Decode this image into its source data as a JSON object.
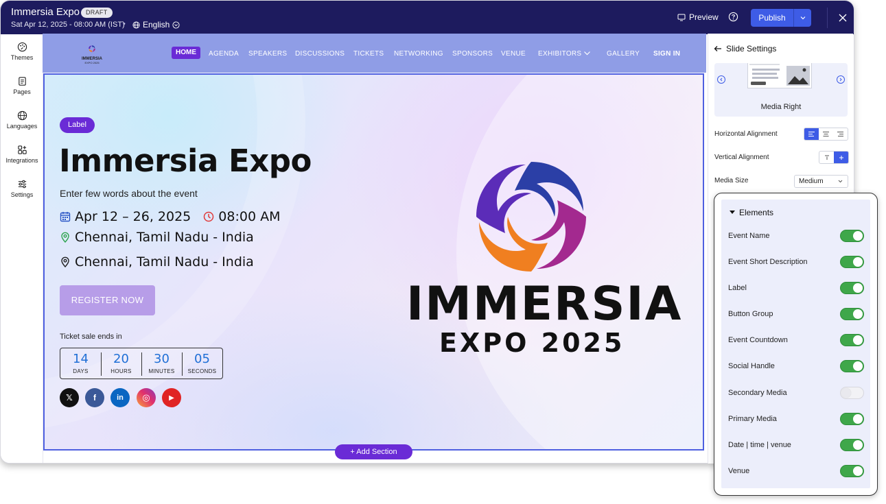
{
  "header": {
    "app_title": "Immersia Expo",
    "status_badge": "DRAFT",
    "event_date": "Sat Apr 12, 2025 - 08:00 AM (IST)",
    "separator": "•",
    "language": "English",
    "preview_label": "Preview",
    "publish_label": "Publish",
    "colors": {
      "topbar": "#1d1b5e",
      "publish": "#3e5ce6"
    }
  },
  "sidebar": {
    "items": [
      {
        "label": "Themes",
        "icon": "palette-icon"
      },
      {
        "label": "Pages",
        "icon": "pages-icon"
      },
      {
        "label": "Languages",
        "icon": "globe-icon"
      },
      {
        "label": "Integrations",
        "icon": "integrations-icon"
      },
      {
        "label": "Settings",
        "icon": "sliders-icon"
      }
    ]
  },
  "site": {
    "logo": {
      "line1": "IMMERSIA",
      "line2": "EXPO 2025"
    },
    "nav": [
      "HOME",
      "AGENDA",
      "SPEAKERS",
      "DISCUSSIONS",
      "TICKETS",
      "NETWORKING",
      "SPONSORS",
      "VENUE",
      "EXHIBITORS",
      "GALLERY",
      "SIGN IN"
    ],
    "nav_accent": "#6a2bd6",
    "nav_bg": "#8f9de6"
  },
  "hero": {
    "label": "Label",
    "title": "Immersia Expo",
    "description": "Enter few words about the event",
    "date_range": "Apr 12 – 26, 2025",
    "time": "08:00 AM",
    "venue_1": "Chennai, Tamil Nadu - India",
    "venue_2": "Chennai, Tamil Nadu - India",
    "register_label": "REGISTER NOW",
    "ticket_sale_text": "Ticket sale ends in",
    "countdown": [
      {
        "value": "14",
        "unit": "DAYS"
      },
      {
        "value": "20",
        "unit": "HOURS"
      },
      {
        "value": "30",
        "unit": "MINUTES"
      },
      {
        "value": "05",
        "unit": "SECONDS"
      }
    ],
    "socials": [
      {
        "name": "x-icon",
        "glyph": "𝕏",
        "color": "#111111"
      },
      {
        "name": "facebook-icon",
        "glyph": "f",
        "color": "#3b5998"
      },
      {
        "name": "linkedin-icon",
        "glyph": "in",
        "color": "#0a66c2"
      },
      {
        "name": "instagram-icon",
        "glyph": "◎",
        "color": "#e1306c"
      },
      {
        "name": "youtube-icon",
        "glyph": "▶",
        "color": "#e02424"
      }
    ],
    "brand_line1": "IMMERSIA",
    "brand_line2": "EXPO 2025"
  },
  "add_section_label": "+ Add Section",
  "settings": {
    "title": "Slide Settings",
    "layout_name": "Media Right",
    "horizontal_alignment_label": "Horizontal Alignment",
    "vertical_alignment_label": "Vertical Alignment",
    "media_size_label": "Media Size",
    "media_size_value": "Medium"
  },
  "elements": {
    "title": "Elements",
    "items": [
      {
        "label": "Event Name",
        "enabled": true
      },
      {
        "label": "Event Short Description",
        "enabled": true
      },
      {
        "label": "Label",
        "enabled": true
      },
      {
        "label": "Button Group",
        "enabled": true
      },
      {
        "label": "Event Countdown",
        "enabled": true
      },
      {
        "label": "Social Handle",
        "enabled": true
      },
      {
        "label": "Secondary Media",
        "enabled": false
      },
      {
        "label": "Primary Media",
        "enabled": true
      },
      {
        "label": "Date | time | venue",
        "enabled": true
      },
      {
        "label": "Venue",
        "enabled": true
      }
    ]
  }
}
